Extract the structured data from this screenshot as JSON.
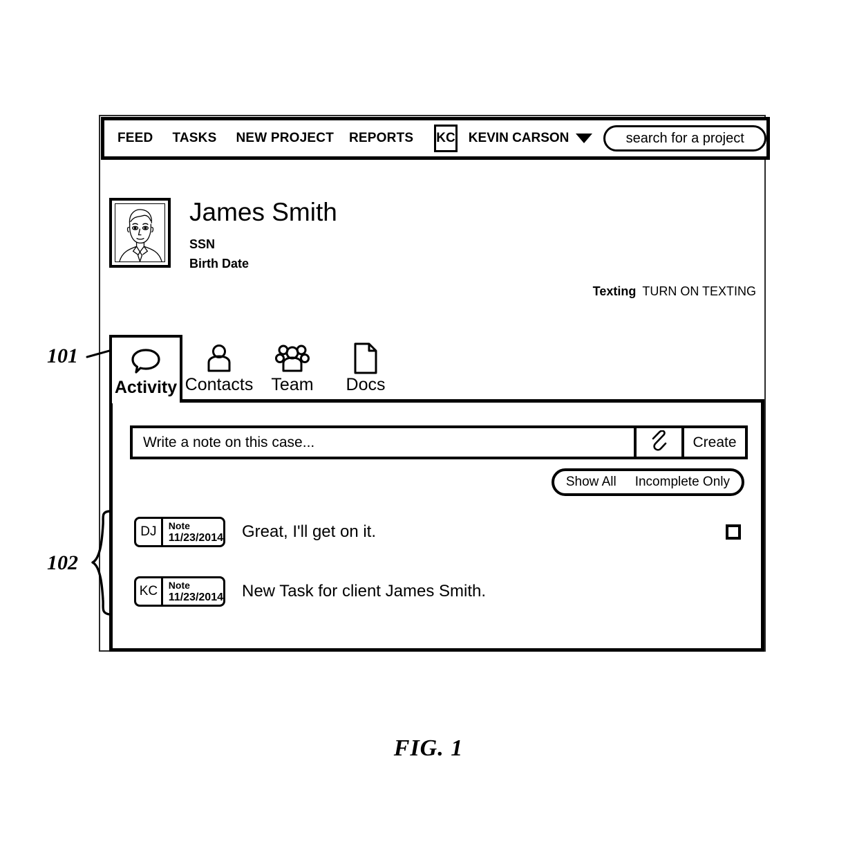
{
  "figure": {
    "caption": "FIG. 1",
    "references": [
      {
        "id": "101",
        "label": "101"
      },
      {
        "id": "102",
        "label": "102"
      }
    ]
  },
  "navbar": {
    "links": [
      {
        "name": "feed",
        "label": "FEED"
      },
      {
        "name": "tasks",
        "label": "TASKS"
      },
      {
        "name": "new-project",
        "label": "NEW PROJECT"
      },
      {
        "name": "reports",
        "label": "REPORTS"
      }
    ],
    "user": {
      "initials": "KC",
      "name": "KEVIN CARSON",
      "caret_icon": "chevron-down-icon"
    },
    "search": {
      "placeholder": "search for a project",
      "value": "search for a project"
    }
  },
  "profile": {
    "avatar_icon": "person-portrait-icon",
    "name": "James Smith",
    "fields": [
      {
        "name": "ssn",
        "label": "SSN"
      },
      {
        "name": "birth-date",
        "label": "Birth Date"
      }
    ]
  },
  "texting": {
    "label": "Texting",
    "action": "TURN ON TEXTING"
  },
  "tabs": [
    {
      "name": "activity",
      "label": "Activity",
      "icon": "speech-bubble-icon",
      "active": true
    },
    {
      "name": "contacts",
      "label": "Contacts",
      "icon": "person-icon",
      "active": false
    },
    {
      "name": "team",
      "label": "Team",
      "icon": "people-group-icon",
      "active": false
    },
    {
      "name": "docs",
      "label": "Docs",
      "icon": "document-page-icon",
      "active": false
    }
  ],
  "composer": {
    "placeholder": "Write a note on this case...",
    "value": "Write a note on this case...",
    "attach_icon": "paperclip-icon",
    "create_label": "Create"
  },
  "filter": {
    "show_all": "Show All",
    "incomplete_only": "Incomplete Only"
  },
  "activity": [
    {
      "initials": "DJ",
      "type": "Note",
      "date": "11/23/2014",
      "text": "Great, I'll get on it.",
      "has_checkbox": true,
      "checked": false
    },
    {
      "initials": "KC",
      "type": "Note",
      "date": "11/23/2014",
      "text": "New Task for client James Smith.",
      "has_checkbox": false,
      "checked": false
    }
  ],
  "colors": {
    "ink": "#000000",
    "frame": "#2a2a2a",
    "background": "#ffffff"
  }
}
